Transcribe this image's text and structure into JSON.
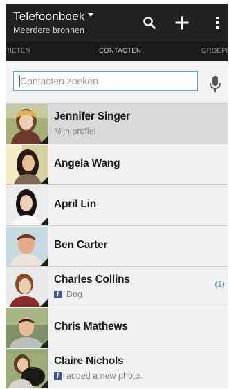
{
  "header": {
    "title": "Telefoonboek",
    "subtitle": "Meerdere bronnen"
  },
  "tabs": [
    {
      "label": "RIETEN",
      "active": false
    },
    {
      "label": "CONTACTEN",
      "active": true
    },
    {
      "label": "GROEPE",
      "active": false
    }
  ],
  "search": {
    "placeholder": "Contacten zoeken"
  },
  "contacts": [
    {
      "name": "Jennifer Singer",
      "subtitle": "Mijn profiel",
      "source": "",
      "count": ""
    },
    {
      "name": "Angela Wang",
      "subtitle": "",
      "source": "",
      "count": ""
    },
    {
      "name": "April Lin",
      "subtitle": "",
      "source": "",
      "count": ""
    },
    {
      "name": "Ben Carter",
      "subtitle": "",
      "source": "",
      "count": ""
    },
    {
      "name": "Charles Collins",
      "subtitle": "Dog",
      "source": "facebook",
      "count": "(1)"
    },
    {
      "name": "Chris Mathews",
      "subtitle": "",
      "source": "",
      "count": ""
    },
    {
      "name": "Claire Nichols",
      "subtitle": "added a new photo.",
      "source": "facebook",
      "count": ""
    }
  ],
  "icons": {
    "search": "search-icon",
    "add": "add-icon",
    "overflow": "more-vertical-icon",
    "mic": "microphone-icon",
    "facebook": "facebook-icon",
    "dropdown": "caret-down-icon"
  },
  "colors": {
    "actionbar": "#222222",
    "tabbar": "#1b1b1b",
    "accent": "#5fa7d8",
    "facebook": "#3b5aa0",
    "count": "#4a9ad8"
  }
}
